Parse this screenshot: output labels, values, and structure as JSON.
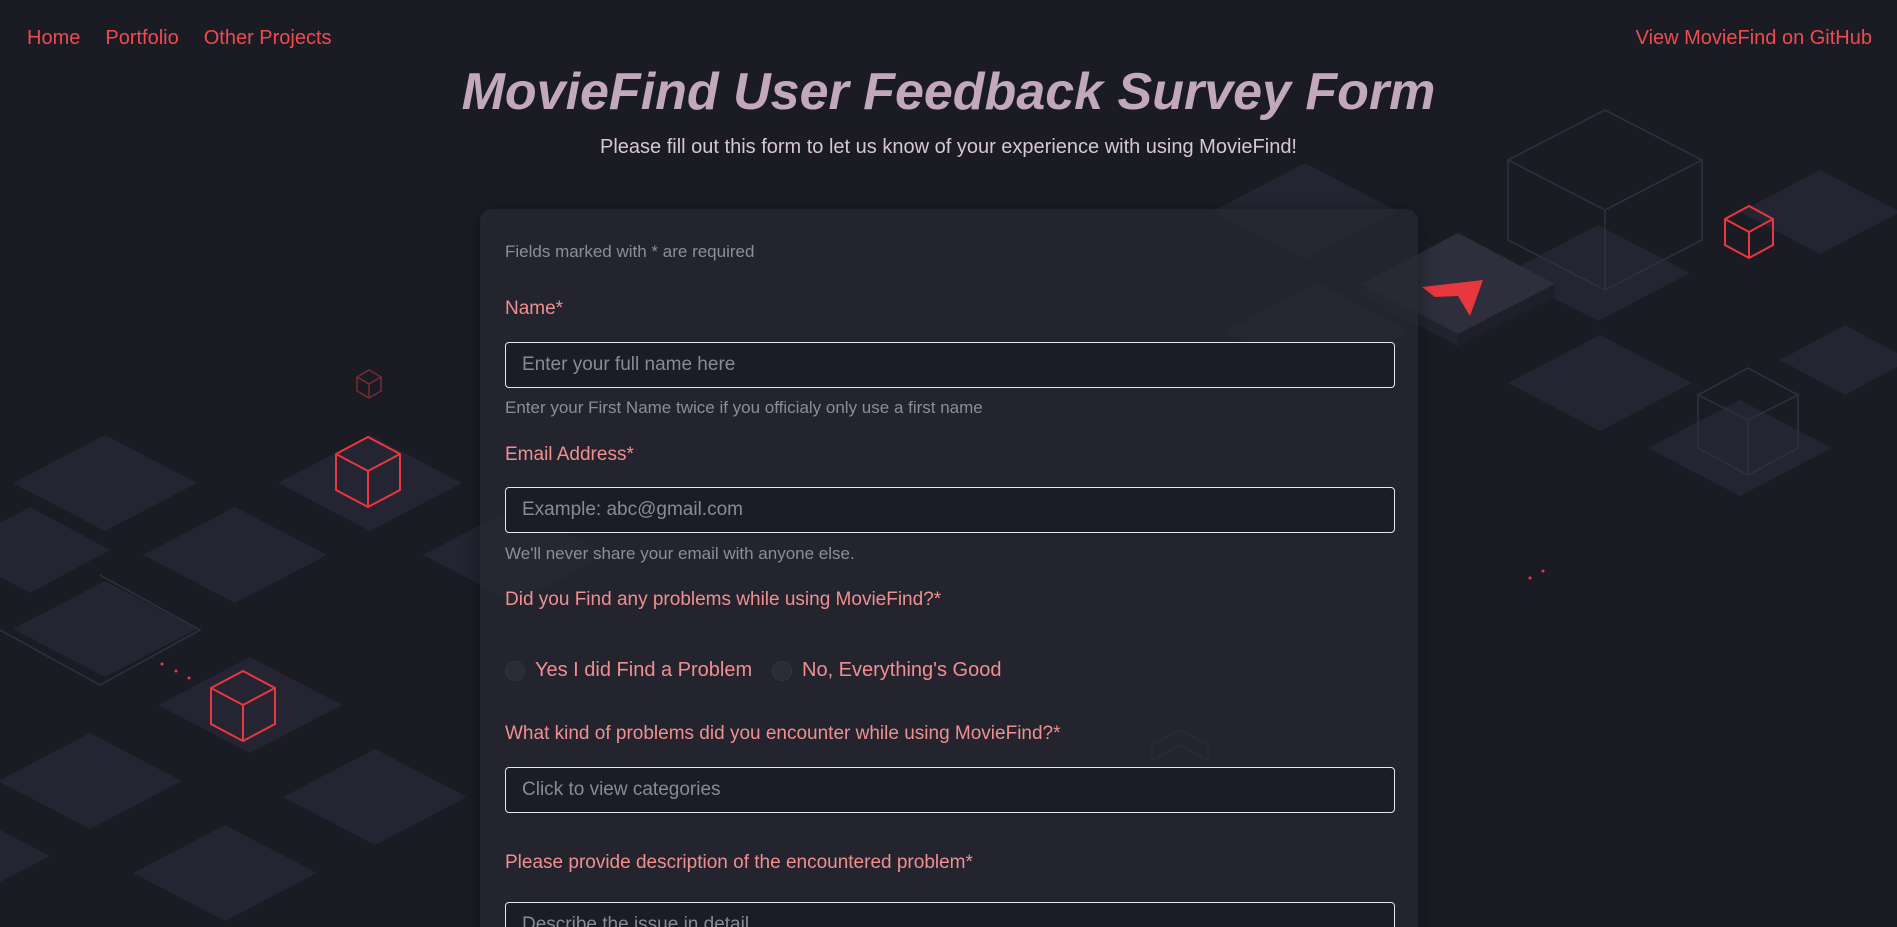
{
  "nav": {
    "home": "Home",
    "portfolio": "Portfolio",
    "other_projects": "Other Projects",
    "github": "View MovieFind on GitHub"
  },
  "header": {
    "title": "MovieFind User Feedback Survey Form",
    "subtitle": "Please fill out this form to let us know of your experience with using MovieFind!"
  },
  "form": {
    "required_note": "Fields marked with * are required",
    "name": {
      "label": "Name*",
      "placeholder": "Enter your full name here",
      "help": "Enter your First Name twice if you officialy only use a first name"
    },
    "email": {
      "label": "Email Address*",
      "placeholder": "Example: abc@gmail.com",
      "help": "We'll never share your email with anyone else."
    },
    "problems_found": {
      "label": "Did you Find any problems while using MovieFind?*",
      "options": [
        "Yes I did Find a Problem",
        "No, Everything's Good"
      ]
    },
    "problem_kind": {
      "label": "What kind of problems did you encounter while using MovieFind?*",
      "placeholder": "Click to view categories"
    },
    "description": {
      "label": "Please provide description of the encountered problem*",
      "placeholder": "Describe the issue in detail"
    }
  },
  "colors": {
    "accent": "#ef4b4f",
    "background": "#1b1b24",
    "label": "#f08f8f",
    "title": "#c2a8bc"
  }
}
